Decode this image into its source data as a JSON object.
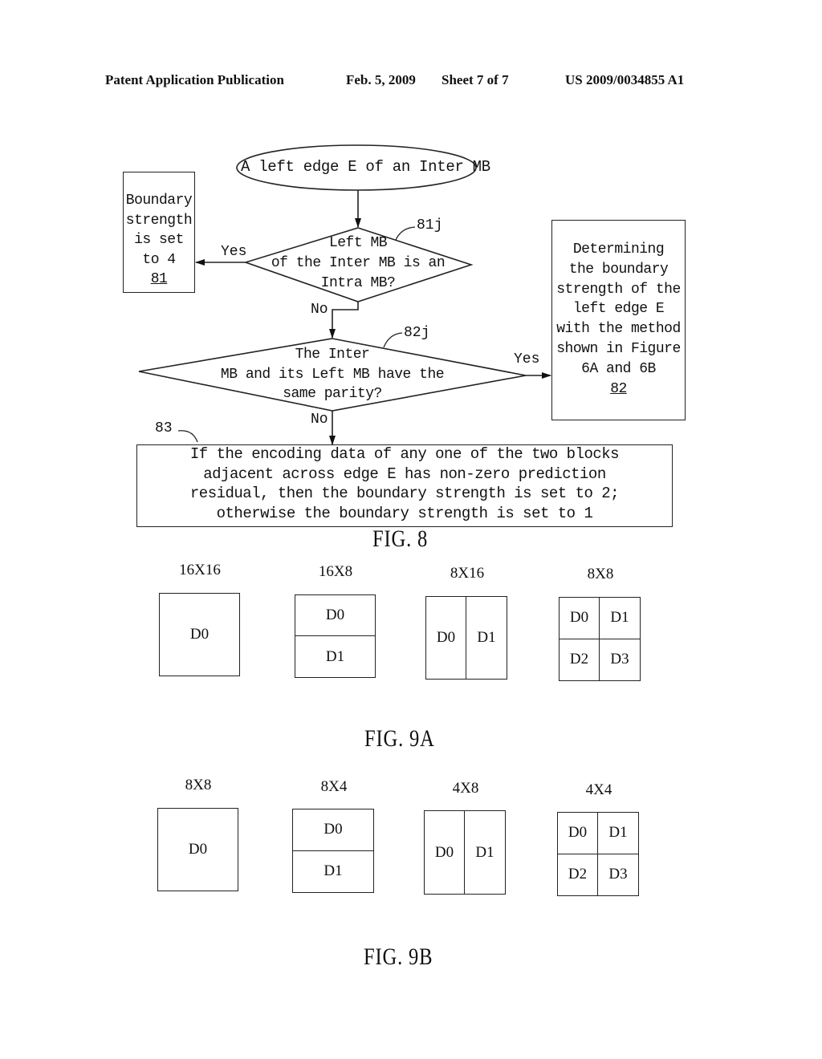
{
  "header": {
    "publication": "Patent Application Publication",
    "date": "Feb. 5, 2009",
    "sheet": "Sheet 7 of 7",
    "number": "US 2009/0034855 A1"
  },
  "fig8": {
    "caption": "FIG. 8",
    "start": "A left edge E of an Inter MB",
    "decision1": {
      "lines": [
        "Left MB",
        "of the Inter MB is an",
        "Intra MB?"
      ],
      "ref": "81j",
      "yes": "Yes",
      "no": "No"
    },
    "box81": {
      "lines": [
        "Boundary",
        "strength",
        "is set",
        "to 4"
      ],
      "ref": "81"
    },
    "decision2": {
      "lines": [
        "The Inter",
        "MB and its Left MB have the",
        "same parity?"
      ],
      "ref": "82j",
      "yes": "Yes",
      "no": "No"
    },
    "box82": {
      "lines": [
        "Determining",
        "the boundary",
        "strength of the",
        "left edge E",
        "with the method",
        "shown in Figure",
        "6A and 6B"
      ],
      "ref": "82"
    },
    "box83": {
      "ref": "83",
      "lines": [
        "If the encoding data of any one of the two blocks",
        "adjacent across edge E has non-zero prediction",
        "residual, then the boundary strength is set to 2;",
        "otherwise the boundary strength is set to 1"
      ]
    }
  },
  "fig9a": {
    "caption": "FIG. 9A",
    "partitions": [
      {
        "title": "16X16",
        "cells": [
          "D0"
        ]
      },
      {
        "title": "16X8",
        "cells": [
          "D0",
          "D1"
        ]
      },
      {
        "title": "8X16",
        "cells": [
          "D0",
          "D1"
        ]
      },
      {
        "title": "8X8",
        "cells": [
          "D0",
          "D1",
          "D2",
          "D3"
        ]
      }
    ]
  },
  "fig9b": {
    "caption": "FIG. 9B",
    "partitions": [
      {
        "title": "8X8",
        "cells": [
          "D0"
        ]
      },
      {
        "title": "8X4",
        "cells": [
          "D0",
          "D1"
        ]
      },
      {
        "title": "4X8",
        "cells": [
          "D0",
          "D1"
        ]
      },
      {
        "title": "4X4",
        "cells": [
          "D0",
          "D1",
          "D2",
          "D3"
        ]
      }
    ]
  }
}
